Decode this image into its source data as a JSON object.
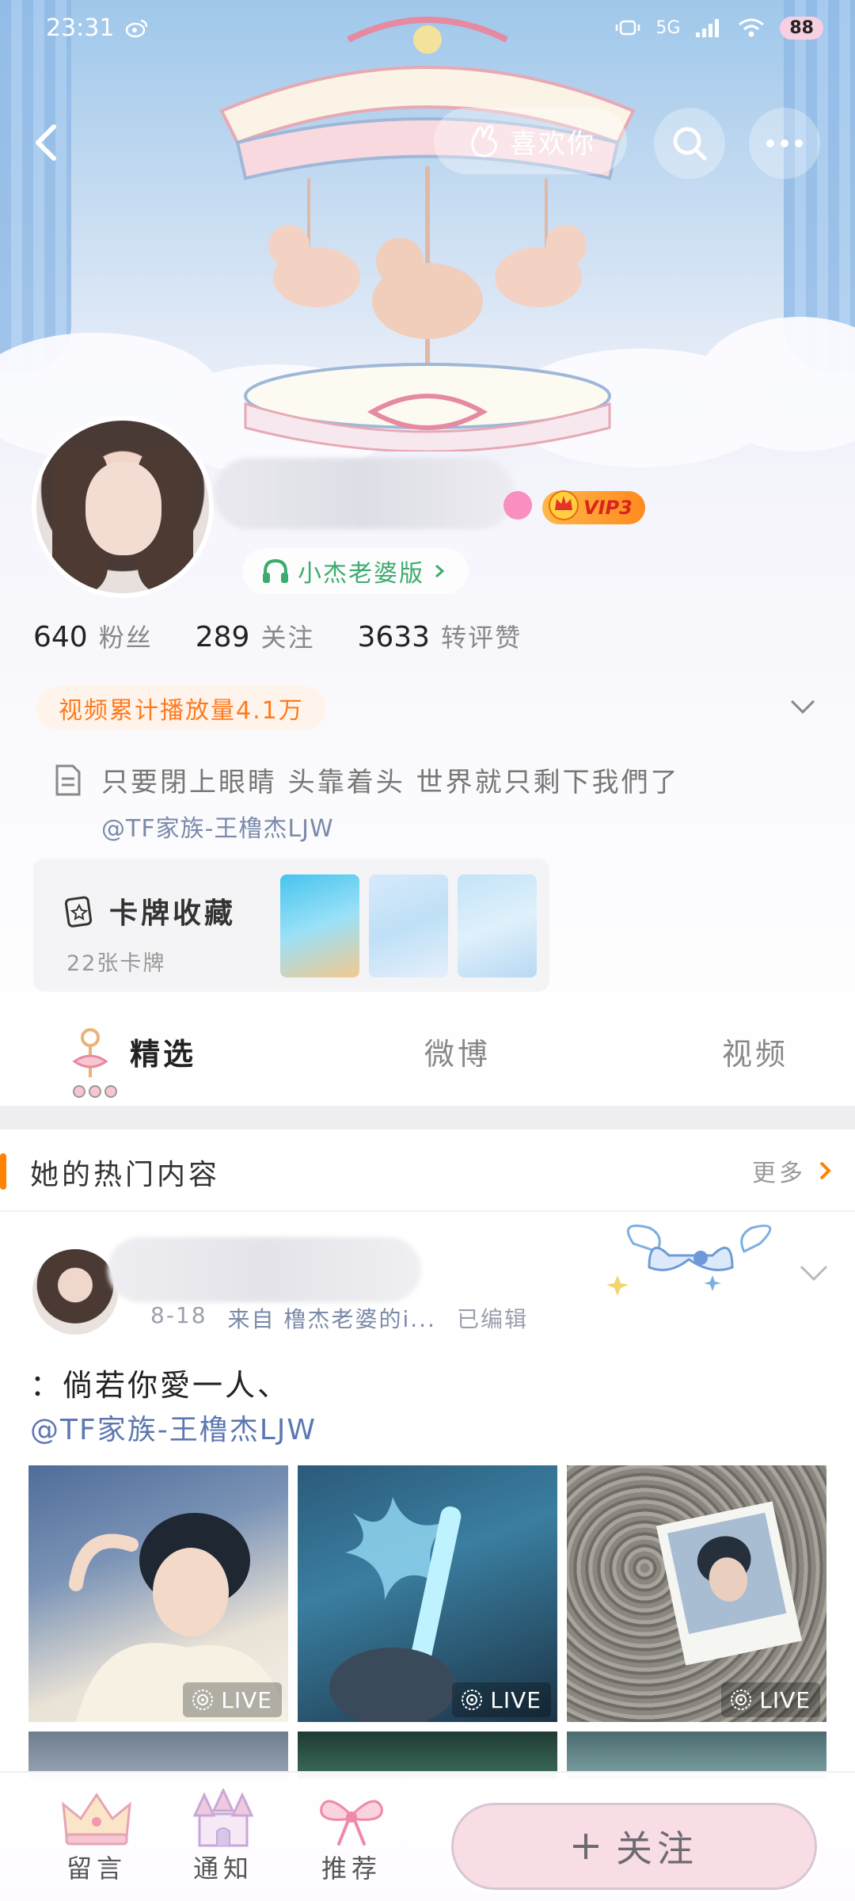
{
  "status": {
    "time": "23:31",
    "network": "5G",
    "battery": "88"
  },
  "nav": {
    "like_label": "喜欢你"
  },
  "profile": {
    "music_label": "小杰老婆版",
    "vip_label": "VIP3",
    "stats": [
      {
        "num": "640",
        "label": "粉丝"
      },
      {
        "num": "289",
        "label": "关注"
      },
      {
        "num": "3633",
        "label": "转评赞"
      }
    ],
    "play_count": "视频累计播放量4.1万",
    "bio": "只要閉上眼睛 头靠着头 世界就只剩下我們了",
    "bio_mention": "@TF家族-王橹杰LJW"
  },
  "cards": {
    "title": "卡牌收藏",
    "count": "22张卡牌"
  },
  "tabs": [
    {
      "label": "精选",
      "active": true
    },
    {
      "label": "微博",
      "active": false
    },
    {
      "label": "视频",
      "active": false
    }
  ],
  "hot": {
    "title": "她的热门内容",
    "more": "更多"
  },
  "post": {
    "date": "8-18",
    "source": "来自 橹杰老婆的i...",
    "edited": "已编辑",
    "text": "：倘若你愛一人、",
    "mention": "@TF家族-王橹杰LJW",
    "live_label": "LIVE"
  },
  "bottom": {
    "items": [
      "留言",
      "通知",
      "推荐"
    ],
    "follow": "关注"
  },
  "colors": {
    "accent": "#ff8200",
    "music": "#3cab6d",
    "mention": "#5c78b0"
  }
}
